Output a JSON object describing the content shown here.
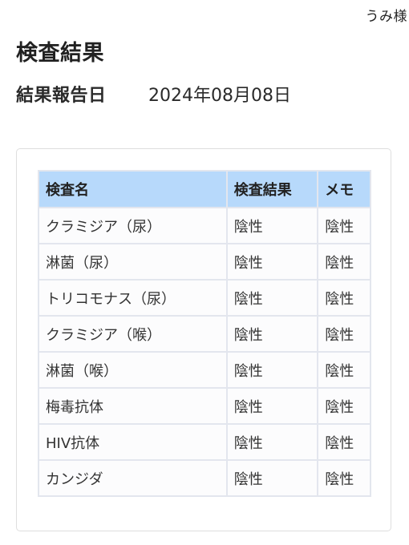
{
  "header": {
    "user_name": "うみ様"
  },
  "page": {
    "title": "検査結果",
    "report_date_label": "結果報告日",
    "report_date_value": "2024年08月08日"
  },
  "colors": {
    "table_header_bg": "#b7d9fb",
    "table_border": "#e3e6ee",
    "card_border": "#dedede"
  },
  "table": {
    "columns": [
      "検査名",
      "検査結果",
      "メモ"
    ],
    "rows": [
      {
        "name": "クラミジア（尿）",
        "result": "陰性",
        "memo": "陰性"
      },
      {
        "name": "淋菌（尿）",
        "result": "陰性",
        "memo": "陰性"
      },
      {
        "name": "トリコモナス（尿）",
        "result": "陰性",
        "memo": "陰性"
      },
      {
        "name": "クラミジア（喉）",
        "result": "陰性",
        "memo": "陰性"
      },
      {
        "name": "淋菌（喉）",
        "result": "陰性",
        "memo": "陰性"
      },
      {
        "name": "梅毒抗体",
        "result": "陰性",
        "memo": "陰性"
      },
      {
        "name": "HIV抗体",
        "result": "陰性",
        "memo": "陰性"
      },
      {
        "name": "カンジダ",
        "result": "陰性",
        "memo": "陰性"
      }
    ]
  }
}
